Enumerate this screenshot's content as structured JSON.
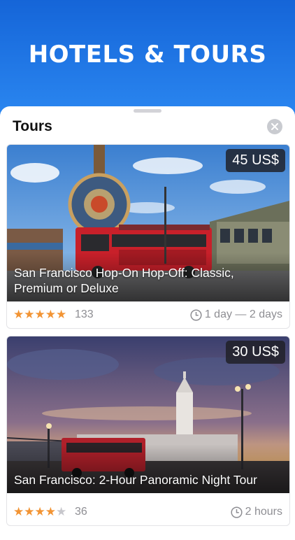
{
  "header": {
    "title": "HOTELS & TOURS"
  },
  "sheet": {
    "title": "Tours"
  },
  "tours": [
    {
      "price": "45 US$",
      "title": "San Francisco Hop-On Hop-Off: Classic, Premium or Deluxe",
      "rating": 5,
      "reviews": "133",
      "duration": "1 day — 2 days"
    },
    {
      "price": "30 US$",
      "title": "San Francisco: 2-Hour Panoramic Night Tour",
      "rating": 4,
      "reviews": "36",
      "duration": "2 hours"
    }
  ],
  "colors": {
    "header": "#1a6fe0",
    "star": "#f29434",
    "price_badge": "#1e1e24"
  }
}
